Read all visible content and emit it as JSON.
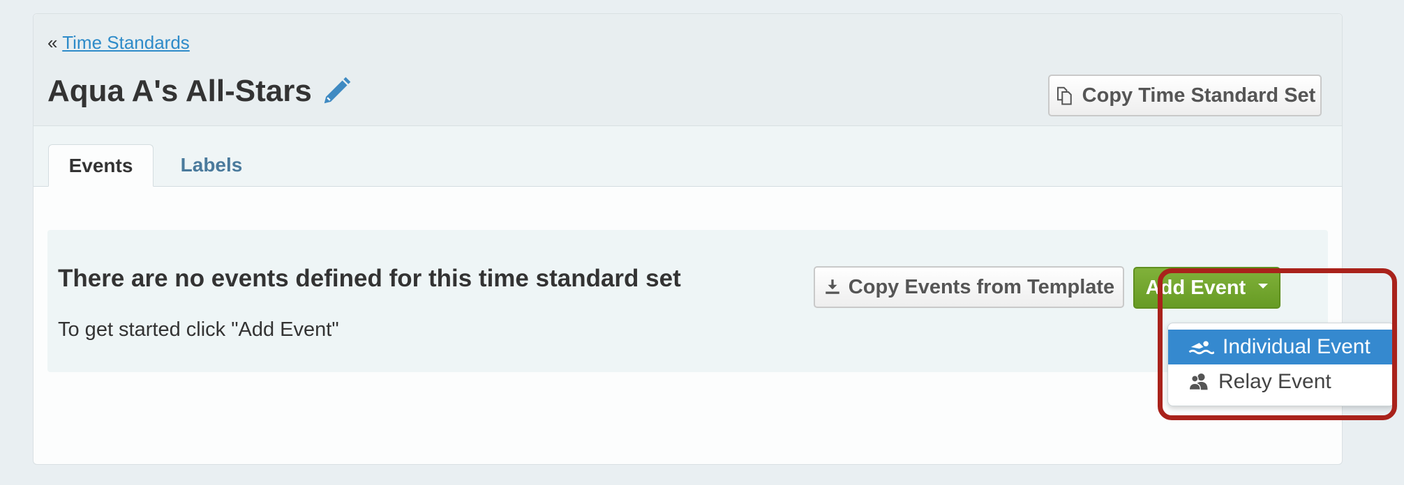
{
  "breadcrumb": {
    "prefix": "«",
    "link_label": "Time Standards"
  },
  "page": {
    "title": "Aqua A's All-Stars"
  },
  "header": {
    "copy_set_label": "Copy Time Standard Set"
  },
  "tabs": [
    {
      "label": "Events",
      "active": true
    },
    {
      "label": "Labels",
      "active": false
    }
  ],
  "empty_state": {
    "title": "There are no events defined for this time standard set",
    "subtitle": "To get started click \"Add Event\""
  },
  "actions": {
    "copy_events_label": "Copy Events from Template",
    "add_event_label": "Add Event"
  },
  "dropdown": {
    "items": [
      {
        "label": "Individual Event",
        "icon": "swimmer-icon",
        "selected": true
      },
      {
        "label": "Relay Event",
        "icon": "relay-users-icon",
        "selected": false
      }
    ]
  },
  "colors": {
    "link": "#2e8bc9",
    "add_button": "#72a52e",
    "selected_item": "#3589cf",
    "highlight_ring": "#a9221b"
  }
}
